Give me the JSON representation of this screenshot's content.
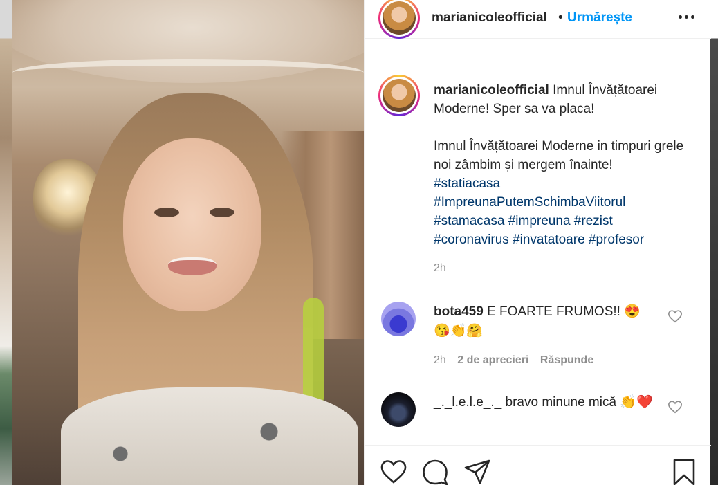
{
  "post": {
    "username": "marianicoleofficial",
    "follow_label": "Urmărește",
    "header_dot": "•",
    "caption_line1": "Imnul Învățătoarei Moderne! Sper sa va placa!",
    "caption_line2": "Imnul Învățătoarei Moderne in timpuri grele noi zâmbim și mergem înainte!",
    "hashtags": [
      "#statiacasa",
      "#ImpreunaPutemSchimbaViitorul",
      "#stamacasa",
      "#impreuna",
      "#rezist",
      "#coronavirus",
      "#invatatoare",
      "#profesor"
    ],
    "time": "2h"
  },
  "comments": [
    {
      "username": "bota459",
      "text": "E FOARTE FRUMOS!!",
      "emojis": "😍😘👏🤗",
      "time": "2h",
      "likes": "2 de aprecieri",
      "reply_label": "Răspunde"
    },
    {
      "username": "_._l.e.l.e_._",
      "text": "bravo minune mică",
      "emojis": "👏❤️"
    }
  ],
  "icons": {
    "more": "more-options-icon",
    "like": "heart-icon",
    "comment": "comment-icon",
    "share": "share-icon",
    "save": "bookmark-icon"
  }
}
